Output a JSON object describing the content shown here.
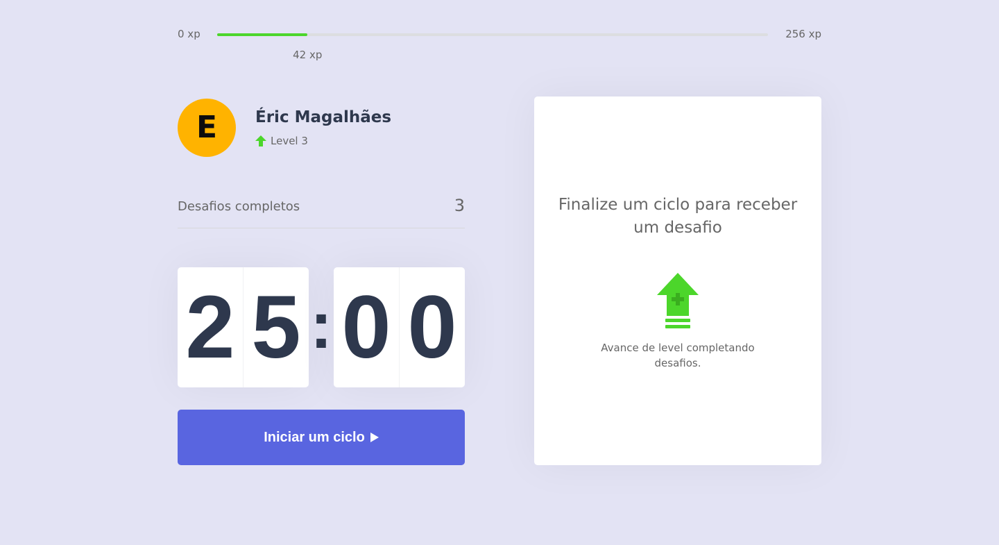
{
  "xp_bar": {
    "min_label": "0 xp",
    "max_label": "256 xp",
    "current_label": "42 xp",
    "current_xp": 42,
    "max_xp": 256,
    "fill_color": "#4cd62b"
  },
  "profile": {
    "avatar_letter": "E",
    "avatar_color": "#ffb300",
    "name": "Éric Magalhães",
    "level_icon": "level-up-arrow-icon",
    "level_label": "Level 3"
  },
  "completed_challenges": {
    "label": "Desafios completos",
    "count": "3"
  },
  "countdown": {
    "minute_left": "2",
    "minute_right": "5",
    "separator": ":",
    "second_left": "0",
    "second_right": "0"
  },
  "start_button": {
    "label": "Iniciar um ciclo",
    "icon": "play-icon",
    "color": "#5965e0"
  },
  "challenge_box": {
    "title": "Finalize um ciclo para receber um desafio",
    "icon": "level-up-icon",
    "hint": "Avance de level completando desafios."
  },
  "colors": {
    "background": "#e3e3f4",
    "text": "#666666",
    "title": "#2e384d",
    "green": "#4cd62b",
    "blue": "#5965e0"
  }
}
